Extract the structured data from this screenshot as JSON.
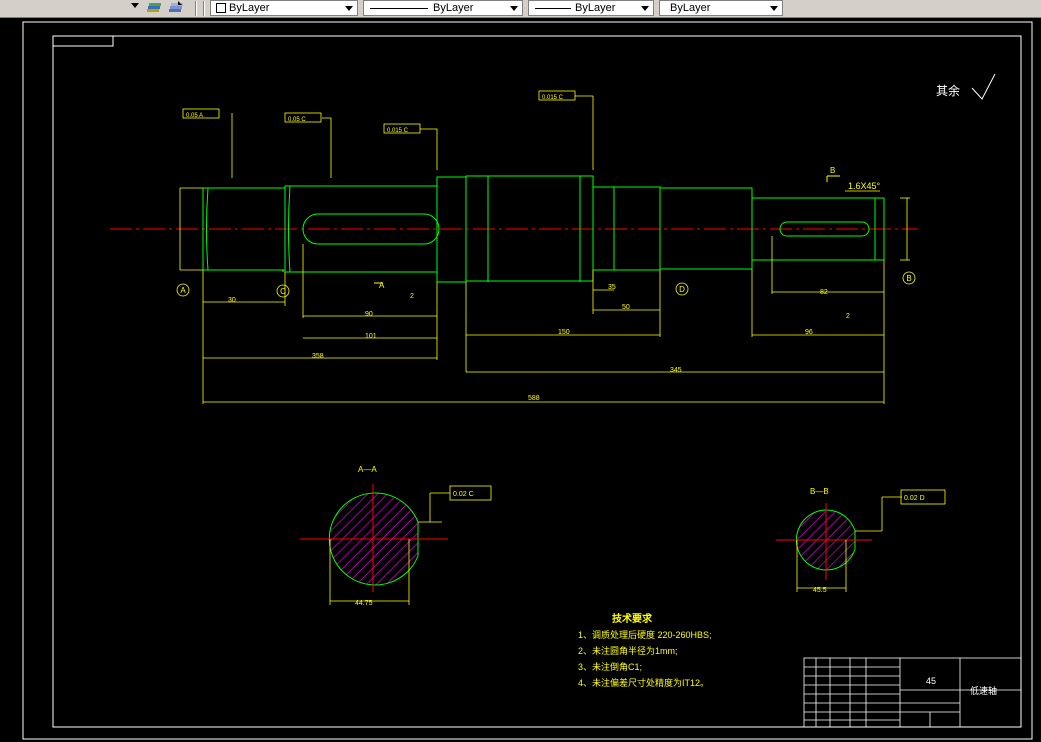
{
  "toolbar": {
    "color_combo": "ByLayer",
    "linetype_combo": "ByLayer",
    "lineweight_combo": "ByLayer",
    "plotstyle_combo": "ByLayer"
  },
  "drawing": {
    "surface_finish_note": "其余",
    "gdt_frames": [
      "0.05 A",
      "0.05 C",
      "0.015 C",
      "0.015 C",
      "0.02 C",
      "0.02 D"
    ],
    "datum_labels": [
      "A",
      "C",
      "D",
      "B"
    ],
    "section_labels": {
      "a": "A—A",
      "b": "B—B",
      "arrow_a": "A",
      "arrow_b": "B"
    },
    "chamfer_note": "1.6X45°",
    "dims_horizontal": [
      "30",
      "2",
      "90",
      "101",
      "358",
      "35",
      "50",
      "150",
      "345",
      "96",
      "82",
      "2",
      "588"
    ],
    "dims_section": [
      "44.75",
      "45.5"
    ],
    "tech_requirements": {
      "title": "技术要求",
      "items": [
        "1、调质处理后硬度 220-260HBS;",
        "2、未注圆角半径为1mm;",
        "3、未注倒角C1;",
        "4、未注偏差尺寸处精度为IT12。"
      ]
    },
    "title_block": {
      "material": "45",
      "part_name": "低速轴"
    }
  },
  "colors": {
    "background": "#000000",
    "geometry": "#00ff00",
    "annotation": "#ffff00",
    "centerline": "#ff0000",
    "hatch": "#ff00ff",
    "frame": "#ffffff",
    "toolbar": "#d4d0c8"
  }
}
